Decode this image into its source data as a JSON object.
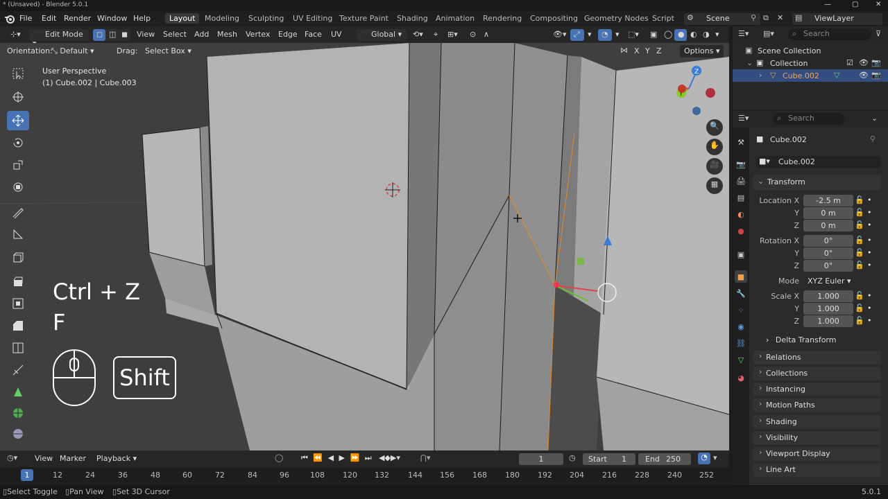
{
  "window": {
    "title": "* (Unsaved) - Blender 5.0.1"
  },
  "menu": {
    "items": [
      "File",
      "Edit",
      "Render",
      "Window",
      "Help"
    ]
  },
  "workspaces": [
    "Layout",
    "Modeling",
    "Sculpting",
    "UV Editing",
    "Texture Paint",
    "Shading",
    "Animation",
    "Rendering",
    "Compositing",
    "Geometry Nodes",
    "Scripting"
  ],
  "scene": "Scene",
  "view_layer": "ViewLayer",
  "viewport_header": {
    "mode": "Edit Mode",
    "view": "View",
    "select": "Select",
    "add": "Add",
    "mesh": "Mesh",
    "vertex": "Vertex",
    "edge": "Edge",
    "face": "Face",
    "uv": "UV",
    "orientation_global": "Global"
  },
  "tool_settings": {
    "orientation_label": "Orientation:",
    "orientation_value": "Default",
    "drag_label": "Drag:",
    "drag_value": "Select Box",
    "axis_x": "X",
    "axis_y": "Y",
    "axis_z": "Z",
    "options": "Options"
  },
  "viewport_info": {
    "perspective": "User Perspective",
    "objects": "(1) Cube.002 | Cube.003"
  },
  "keys": {
    "combo": "Ctrl + Z",
    "key2": "F",
    "modifier": "Shift"
  },
  "outliner": {
    "search_placeholder": "Search",
    "scene_collection": "Scene Collection",
    "collection": "Collection",
    "object": "Cube.002"
  },
  "properties": {
    "search_placeholder": "Search",
    "object_name": "Cube.002",
    "data_name": "Cube.002",
    "transform": "Transform",
    "location_label": "Location X",
    "loc_x": "-2.5 m",
    "loc_y": "0 m",
    "loc_z": "0 m",
    "rotation_label": "Rotation X",
    "rot_x": "0°",
    "rot_y": "0°",
    "rot_z": "0°",
    "mode_label": "Mode",
    "mode_value": "XYZ Euler",
    "scale_label": "Scale X",
    "scale_x": "1.000",
    "scale_y": "1.000",
    "scale_z": "1.000",
    "y": "Y",
    "z": "Z",
    "delta": "Delta Transform",
    "panels": [
      "Relations",
      "Collections",
      "Instancing",
      "Motion Paths",
      "Shading",
      "Visibility",
      "Viewport Display",
      "Line Art"
    ]
  },
  "timeline": {
    "view": "View",
    "marker": "Marker",
    "playback": "Playback",
    "current_frame": "1",
    "start_label": "Start",
    "start": "1",
    "end_label": "End",
    "end": "250",
    "ticks": [
      "1",
      "12",
      "24",
      "36",
      "48",
      "60",
      "72",
      "84",
      "96",
      "108",
      "120",
      "132",
      "144",
      "156",
      "168",
      "180",
      "192",
      "204",
      "216",
      "228",
      "240",
      "252"
    ]
  },
  "status": {
    "left": "Select Toggle",
    "middle": "Pan View",
    "right": "Set 3D Cursor",
    "version": "5.0.1"
  }
}
